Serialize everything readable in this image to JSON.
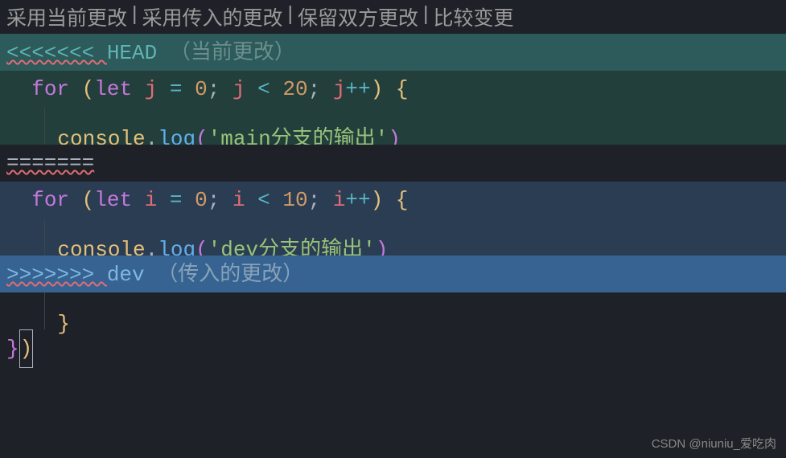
{
  "codelens": {
    "accept_current": "采用当前更改",
    "accept_incoming": "采用传入的更改",
    "accept_both": "保留双方更改",
    "compare": "比较变更"
  },
  "conflict": {
    "head_marker": "<<<<<<< ",
    "head_label": "HEAD",
    "head_desc": "（当前更改）",
    "separator": "=======",
    "incoming_marker": ">>>>>>> ",
    "incoming_label": "dev",
    "incoming_desc": "（传入的更改）"
  },
  "code": {
    "current": {
      "for_kw": "for",
      "let_kw": "let",
      "var1": "j",
      "init": "0",
      "cond_var": "j",
      "cond_op": "<",
      "cond_val": "20",
      "inc_var": "j",
      "inc_op": "++",
      "console": "console",
      "log": "log",
      "message": "'main分支的输出'"
    },
    "incoming": {
      "for_kw": "for",
      "let_kw": "let",
      "var1": "i",
      "init": "0",
      "cond_var": "i",
      "cond_op": "<",
      "cond_val": "10",
      "inc_var": "i",
      "inc_op": "++",
      "console": "console",
      "log": "log",
      "message": "'dev分支的输出'"
    }
  },
  "watermark": "CSDN @niuniu_爱吃肉"
}
